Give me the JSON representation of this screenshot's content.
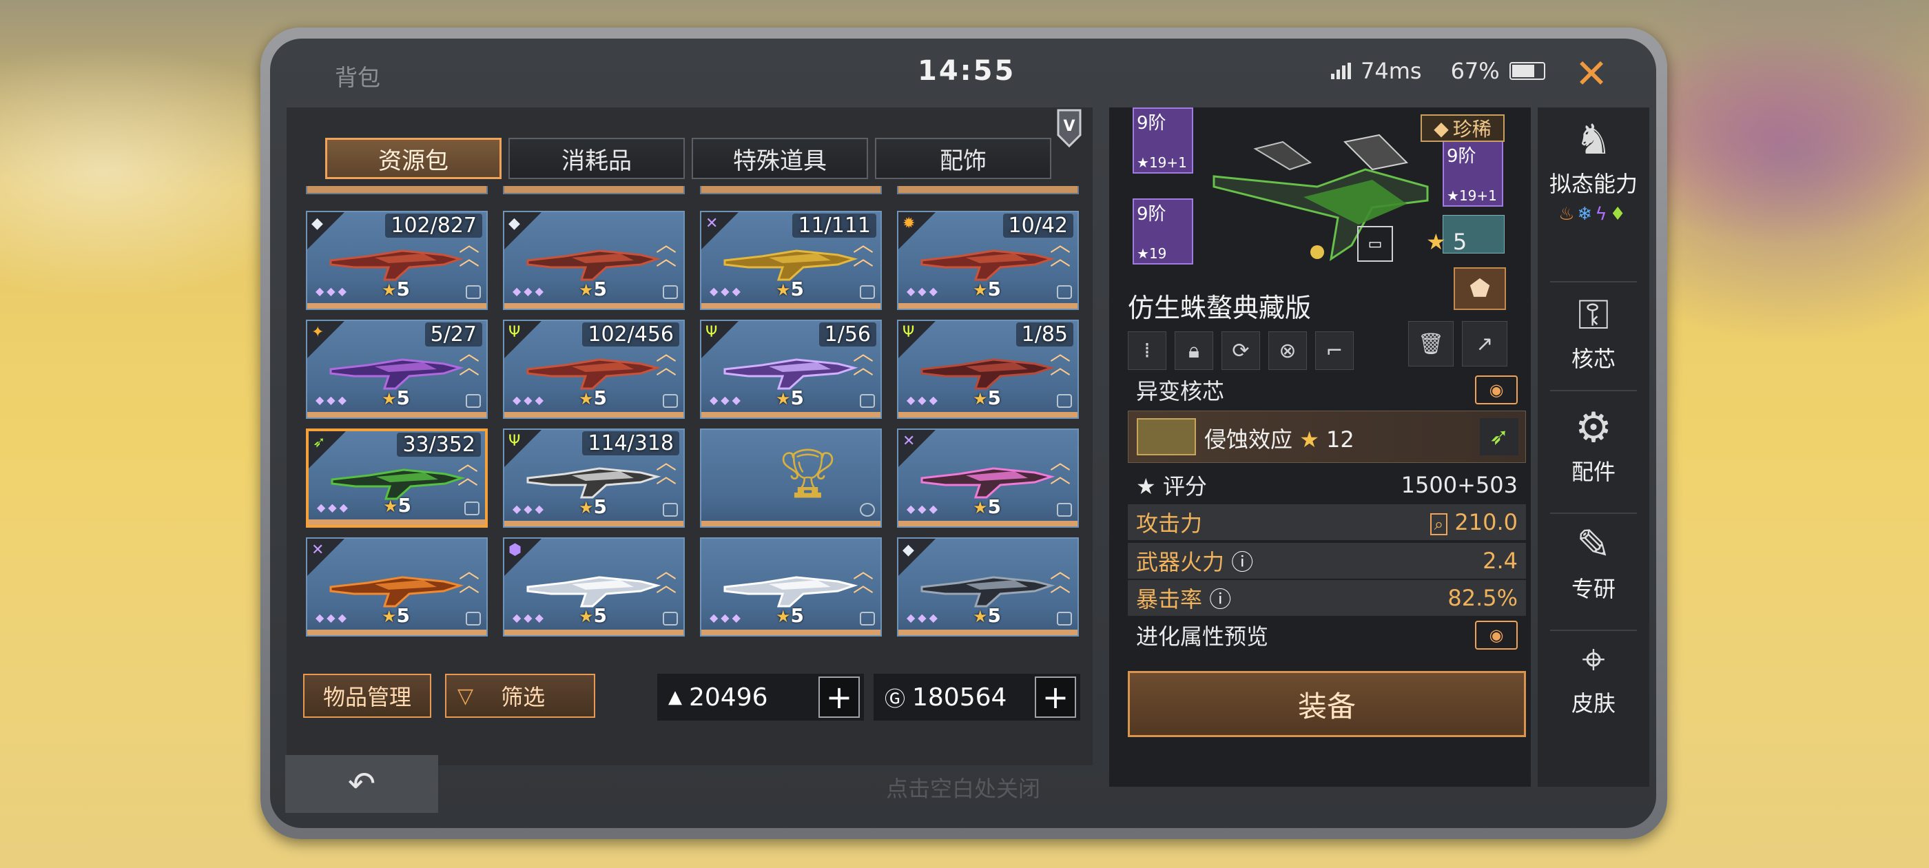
{
  "header": {
    "title": "背包",
    "time": "14:55",
    "ping": "74ms",
    "battery": "67%",
    "close_label": "✕"
  },
  "tabs": [
    {
      "label": "资源包",
      "active": true
    },
    {
      "label": "消耗品",
      "active": false
    },
    {
      "label": "特殊道具",
      "active": false
    },
    {
      "label": "配饰",
      "active": false
    }
  ],
  "items": [
    {
      "count": "102/827",
      "level": "5",
      "icon": "diamond-icon",
      "weapon": "rifle-red"
    },
    {
      "count": "",
      "level": "5",
      "icon": "diamond-icon",
      "weapon": "rifle-red-locked"
    },
    {
      "count": "11/111",
      "level": "5",
      "icon": "cross-icon",
      "weapon": "dual-pistols-gold"
    },
    {
      "count": "10/42",
      "level": "5",
      "icon": "gear-icon",
      "weapon": "rifle-red"
    },
    {
      "count": "5/27",
      "level": "5",
      "icon": "fire-icon",
      "weapon": "cannon-purple"
    },
    {
      "count": "102/456",
      "level": "5",
      "icon": "trident-icon",
      "weapon": "rifle-red"
    },
    {
      "count": "1/56",
      "level": "5",
      "icon": "trident-icon",
      "weapon": "crossbow-purple"
    },
    {
      "count": "1/85",
      "level": "5",
      "icon": "trident-icon",
      "weapon": "bow-red"
    },
    {
      "count": "33/352",
      "level": "5",
      "icon": "arrow-icon",
      "weapon": "sniper-green",
      "selected": true
    },
    {
      "count": "114/318",
      "level": "5",
      "icon": "trident-icon",
      "weapon": "rifle-camo"
    },
    {
      "count": "",
      "level": "",
      "icon": "",
      "weapon": "trophy"
    },
    {
      "count": "",
      "level": "5",
      "icon": "cross-icon",
      "weapon": "blade-pink"
    },
    {
      "count": "",
      "level": "5",
      "icon": "cross-icon",
      "weapon": "rocket-orange"
    },
    {
      "count": "",
      "level": "5",
      "icon": "shield-icon",
      "weapon": "sword-white"
    },
    {
      "count": "",
      "level": "5",
      "icon": "",
      "weapon": "sword-white"
    },
    {
      "count": "",
      "level": "5",
      "icon": "diamond-icon",
      "weapon": "mech-suit"
    }
  ],
  "footer": {
    "manage_label": "物品管理",
    "filter_label": "筛选",
    "currency1": "20496",
    "currency2": "180564",
    "close_hint": "点击空白处关闭"
  },
  "detail": {
    "rarity": "珍稀",
    "tier1": {
      "tier": "9阶",
      "stars": "19+1"
    },
    "tier2": {
      "tier": "9阶",
      "stars": "19"
    },
    "tier3": {
      "tier": "9阶",
      "stars": "19+1"
    },
    "level": "5",
    "name": "仿生蛛螯典藏版",
    "mutate_label": "异变核芯",
    "mutate_effect": "侵蚀效应",
    "mutate_level": "12",
    "score_label": "评分",
    "score_value": "1500+503",
    "attack_label": "攻击力",
    "attack_value": "210.0",
    "firepower_label": "武器火力",
    "firepower_value": "2.4",
    "crit_label": "暴击率",
    "crit_value": "82.5%",
    "evolve_label": "进化属性预览",
    "equip_label": "装备"
  },
  "sidenav": [
    {
      "label": "拟态能力",
      "icon": "mimic-icon"
    },
    {
      "label": "核芯",
      "icon": "core-icon"
    },
    {
      "label": "配件",
      "icon": "parts-icon"
    },
    {
      "label": "专研",
      "icon": "research-icon"
    },
    {
      "label": "皮肤",
      "icon": "skin-icon"
    }
  ],
  "colors": {
    "accent": "#f0a45a",
    "card": "#4a6c92",
    "selected": "#f5a23d"
  }
}
